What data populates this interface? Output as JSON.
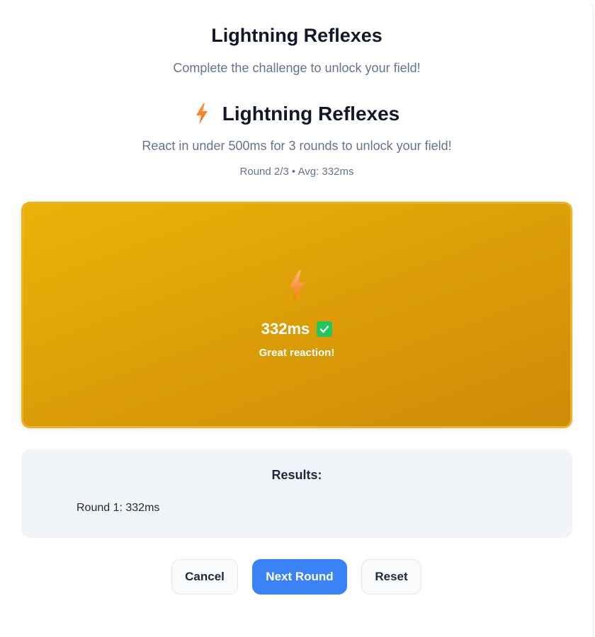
{
  "header": {
    "title": "Lightning Reflexes",
    "subtitle": "Complete the challenge to unlock your field!"
  },
  "challenge": {
    "icon": "lightning-bolt-icon",
    "title": "Lightning Reflexes",
    "description": "React in under 500ms for 3 rounds to unlock your field!",
    "status": "Round 2/3 • Avg: 332ms"
  },
  "reaction_area": {
    "icon": "lightning-bolt-icon",
    "time": "332ms",
    "result_icon": "check-mark-icon",
    "feedback": "Great reaction!",
    "background_color": "#dc9e08"
  },
  "results": {
    "title": "Results:",
    "rounds": [
      "Round 1: 332ms"
    ]
  },
  "buttons": {
    "cancel": "Cancel",
    "next_round": "Next Round",
    "reset": "Reset"
  },
  "colors": {
    "primary": "#3b82f6",
    "accent": "#eab308",
    "success": "#22c55e"
  }
}
